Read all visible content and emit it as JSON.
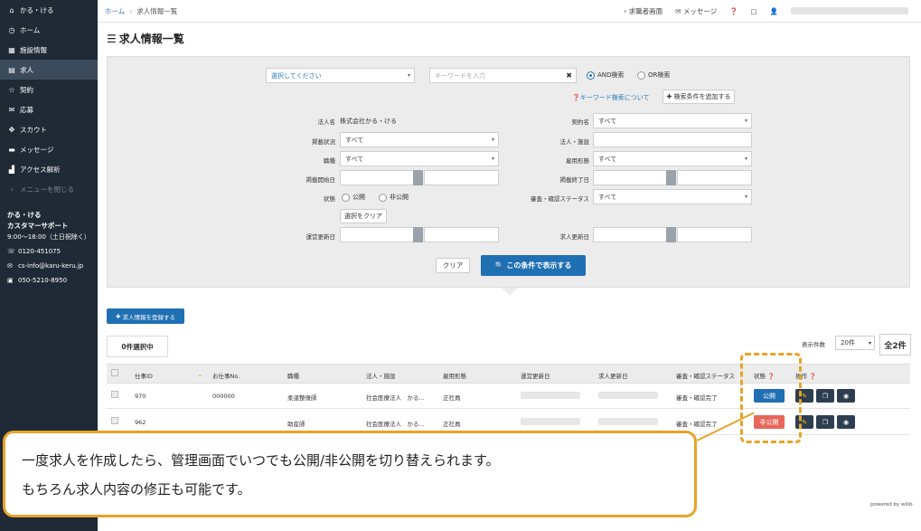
{
  "sidebar": {
    "items": [
      {
        "icon": "home-icon",
        "glyph": "⌂",
        "label": "かる・ける"
      },
      {
        "icon": "clock-icon",
        "glyph": "◷",
        "label": "ホーム"
      },
      {
        "icon": "grid-icon",
        "glyph": "▦",
        "label": "施設情報"
      },
      {
        "icon": "book-icon",
        "glyph": "▤",
        "label": "求人"
      },
      {
        "icon": "star-icon",
        "glyph": "☆",
        "label": "契約"
      },
      {
        "icon": "mail-icon",
        "glyph": "✉",
        "label": "応募"
      },
      {
        "icon": "move-icon",
        "glyph": "✥",
        "label": "スカウト"
      },
      {
        "icon": "chat-icon",
        "glyph": "▬",
        "label": "メッセージ"
      },
      {
        "icon": "bar-chart-icon",
        "glyph": "▟",
        "label": "アクセス解析"
      },
      {
        "icon": "chevron-left-icon",
        "glyph": "‹",
        "label": "メニューを閉じる"
      }
    ],
    "support": {
      "name1": "かる・ける",
      "name2": "カスタマーサポート",
      "hours": "9:00～18:00（土日祝除く）",
      "phone": "0120-451075",
      "email": "cs-info@karu-keru.jp",
      "fax": "050-5210-8950"
    }
  },
  "topbar": {
    "breadcrumb_home": "ホーム",
    "breadcrumb_current": "求人情報一覧",
    "seeker_view": "求職者画面",
    "messages": "メッセージ"
  },
  "page": {
    "title": "求人情報一覧"
  },
  "search": {
    "select_placeholder": "選択してください",
    "keyword_placeholder": "キーワードを入力",
    "and_label": "AND検索",
    "or_label": "OR検索",
    "keyword_help": "キーワード検索について",
    "add_condition": "検索条件を追加する",
    "labels": {
      "corp_name": "法人名",
      "post_status": "掲載状況",
      "job_type": "職種",
      "post_start": "掲載開始日",
      "status": "状態",
      "updated": "運営更新日",
      "contract_name": "契約名",
      "corp_facility": "法人・施設",
      "employment": "雇用形態",
      "post_end": "掲載終了日",
      "review_status": "審査・確認ステータス",
      "job_updated": "求人更新日"
    },
    "values": {
      "corp_name": "株式会社かる・ける",
      "post_status": "すべて",
      "job_type": "すべて",
      "contract_name": "すべて",
      "employment": "すべて",
      "review_status": "すべて"
    },
    "radio_public": "公開",
    "radio_private": "非公開",
    "clear_selection": "選択をクリア",
    "clear": "クリア",
    "submit": "この条件で表示する"
  },
  "register_button": "求人情報を登録する",
  "table": {
    "selected_count": "0件選択中",
    "per_page_label": "表示件数",
    "per_page_value": "20件",
    "total": "全2件",
    "headers": [
      "仕事ID",
      "お仕事No.",
      "職種",
      "法人・施設",
      "雇用形態",
      "運営更新日",
      "求人更新日",
      "審査・確認ステータス",
      "状態",
      "操作"
    ],
    "rows": [
      {
        "id": "970",
        "no": "000000",
        "job": "柔道整復師",
        "corp": "社会医療法人　かる...",
        "emp": "正社員",
        "review": "審査・確認完了",
        "state": "公開",
        "state_color": "#1f6fb3"
      },
      {
        "id": "962",
        "no": "",
        "job": "助産師",
        "corp": "社会医療法人　かる...",
        "emp": "正社員",
        "review": "審査・確認完了",
        "state": "非公開",
        "state_color": "#e8665a"
      }
    ]
  },
  "callout": {
    "line1": "一度求人を作成したら、管理画面でいつでも公開/非公開を切り替えられます。",
    "line2": "もちろん求人内容の修正も可能です。"
  },
  "powered_by": "powered by wilib",
  "colors": {
    "accent": "#1f6fb3",
    "sidebar": "#1f2a36",
    "highlight": "#e8a328",
    "private": "#e8665a"
  }
}
